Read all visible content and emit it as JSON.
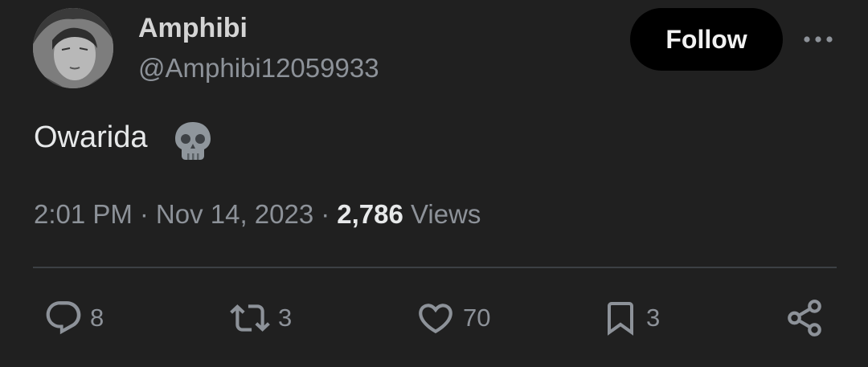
{
  "user": {
    "display_name": "Amphibi",
    "handle": "@Amphibi12059933",
    "avatar": "avatar"
  },
  "follow_button": {
    "label": "Follow"
  },
  "more_button": {
    "icon": "more-dots-icon"
  },
  "tweet": {
    "text": "Owarida",
    "emoji": "skull-emoji"
  },
  "meta": {
    "time": "2:01 PM",
    "separator": "·",
    "date": "Nov 14, 2023",
    "views_count": "2,786",
    "views_label": "Views"
  },
  "actions": {
    "reply": {
      "icon": "reply-icon",
      "count": "8"
    },
    "retweet": {
      "icon": "retweet-icon",
      "count": "3"
    },
    "like": {
      "icon": "heart-icon",
      "count": "70"
    },
    "bookmark": {
      "icon": "bookmark-icon",
      "count": "3"
    },
    "share": {
      "icon": "share-icon"
    }
  },
  "colors": {
    "background": "#202020",
    "primary_text": "#e7e9ea",
    "secondary_text": "#8d9299",
    "follow_bg": "#000000",
    "divider": "#3c4044"
  }
}
